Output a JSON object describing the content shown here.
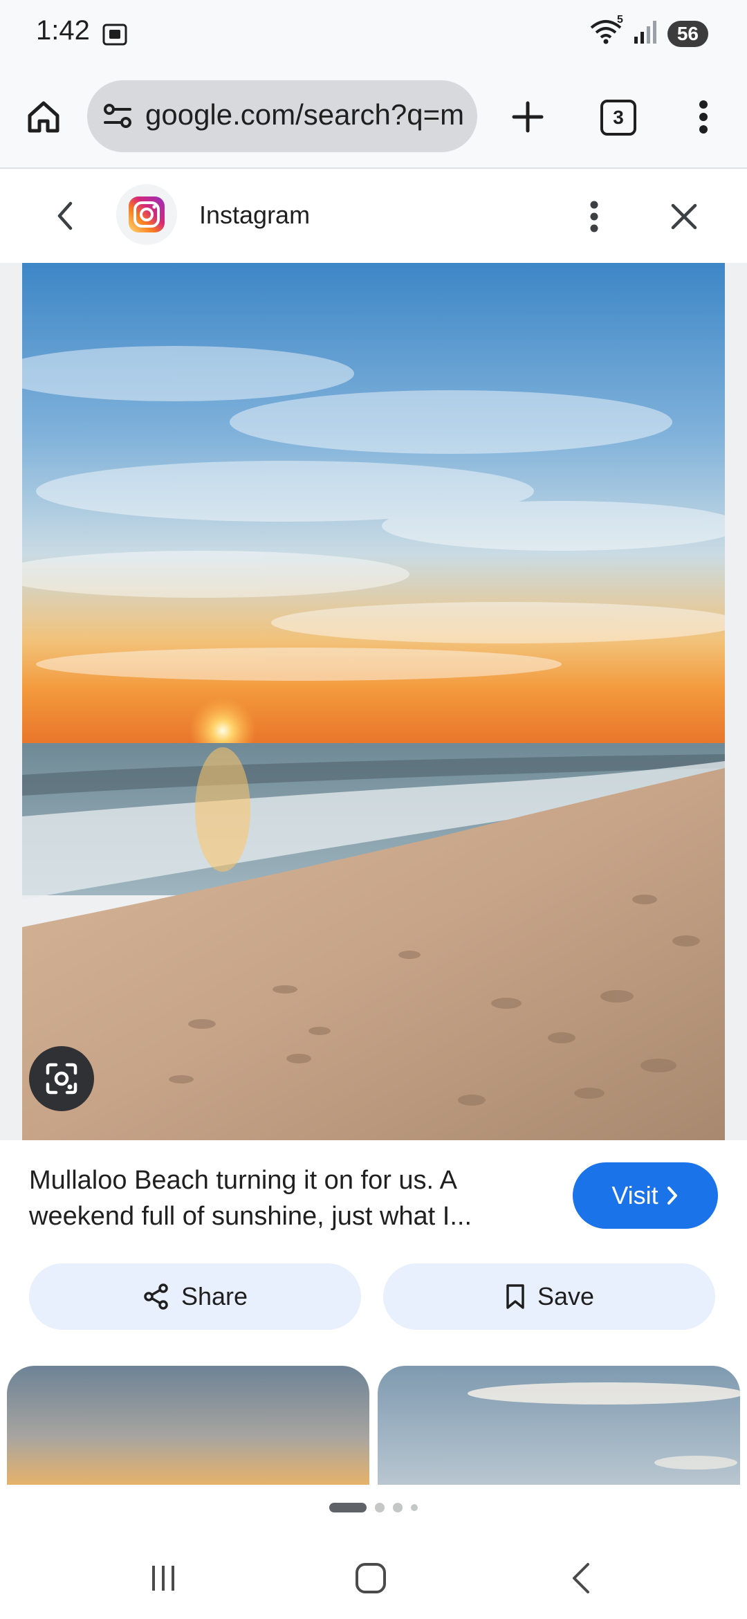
{
  "status_bar": {
    "time": "1:42",
    "battery": "56",
    "wifi_badge": "5",
    "icons": [
      "screenshot-icon",
      "wifi-icon",
      "signal-icon",
      "battery-icon"
    ]
  },
  "browser": {
    "url": "google.com/search?q=m",
    "tab_count": "3",
    "icons": [
      "home-icon",
      "site-settings-icon",
      "plus-icon",
      "tabs-icon",
      "more-vert-icon"
    ]
  },
  "panel": {
    "source_name": "Instagram",
    "icons": [
      "chevron-left-icon",
      "instagram-icon",
      "more-vert-icon",
      "close-icon"
    ]
  },
  "result": {
    "caption": "Mullaloo Beach turning it on for us. A weekend full of sunshine, just what I...",
    "visit_label": "Visit",
    "share_label": "Share",
    "save_label": "Save",
    "lens_icon": "lens-icon"
  },
  "pager": {
    "page_count": 4,
    "active_index": 0
  },
  "system_nav": {
    "icons": [
      "recents-icon",
      "home-icon",
      "back-icon"
    ]
  },
  "colors": {
    "accent": "#1a73e8",
    "chip_background": "#e8f0fe",
    "url_background": "#d7d9dd"
  }
}
